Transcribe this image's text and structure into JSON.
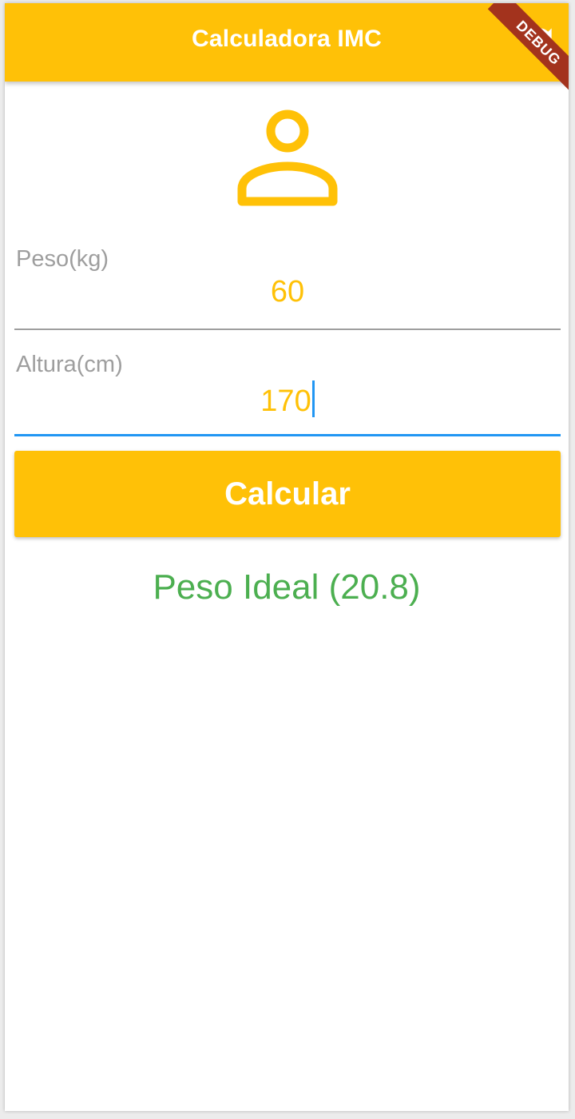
{
  "appbar": {
    "title": "Calculadora IMC",
    "refresh_icon": "refresh-icon",
    "color": "#FFC107"
  },
  "debug_banner": "DEBUG",
  "avatar_icon": "person-outline-icon",
  "form": {
    "weight": {
      "label": "Peso(kg)",
      "value": "60"
    },
    "height": {
      "label": "Altura(cm)",
      "value": "170"
    }
  },
  "button": {
    "label": "Calcular"
  },
  "result": {
    "text": "Peso Ideal (20.8)",
    "color": "#4CAF50"
  }
}
